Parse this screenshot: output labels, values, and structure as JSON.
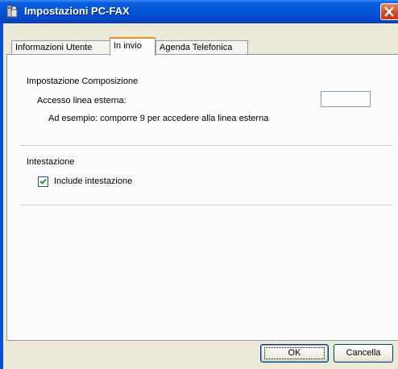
{
  "window": {
    "title": "Impostazioni PC-FAX",
    "app_icon": "fax-settings-icon",
    "close_icon": "close-icon"
  },
  "tabs": [
    {
      "label": "Informazioni Utente",
      "active": false
    },
    {
      "label": "In invio",
      "active": true
    },
    {
      "label": "Agenda Telefonica",
      "active": false
    }
  ],
  "dialing": {
    "section_title": "Impostazione Composizione",
    "outside_line_label": "Accesso linea esterna:",
    "outside_line_value": "",
    "example_text": "Ad esempio: comporre 9 per accedere alla linea esterna"
  },
  "header": {
    "section_title": "Intestazione",
    "include_label": "Include intestazione",
    "include_checked": true
  },
  "buttons": {
    "ok_label": "OK",
    "cancel_label": "Cancella"
  },
  "colors": {
    "titlebar": "#0553d8",
    "close_button": "#d4512a",
    "dialog_background": "#ece9d8",
    "active_tab_highlight": "#e68b2c"
  }
}
